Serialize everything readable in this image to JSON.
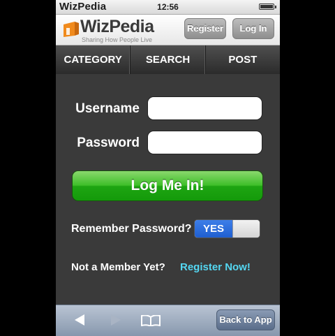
{
  "status_bar": {
    "carrier": "WizPedia",
    "time": "12:56",
    "battery_level": 1.0
  },
  "header": {
    "logo_name": "WizPedia",
    "logo_tagline": "Sharing How People Live",
    "register_label": "Register",
    "login_label": "Log In"
  },
  "nav": {
    "items": [
      "CATEGORY",
      "SEARCH",
      "POST"
    ]
  },
  "form": {
    "username_label": "Username",
    "username_value": "",
    "password_label": "Password",
    "password_value": "",
    "submit_label": "Log Me In!",
    "remember_label": "Remember Password?",
    "remember_toggle": "YES",
    "not_member_text": "Not a Member Yet?",
    "register_link": "Register Now!"
  },
  "toolbar": {
    "back_icon": "back-arrow-icon",
    "forward_icon": "forward-arrow-icon",
    "bookmarks_icon": "book-icon",
    "back_to_app_label": "Back to App"
  },
  "colors": {
    "accent_green": "#1ea512",
    "toggle_blue": "#2a6bdc",
    "link_cyan": "#54d7f2",
    "logo_orange": "#f08a1c"
  }
}
